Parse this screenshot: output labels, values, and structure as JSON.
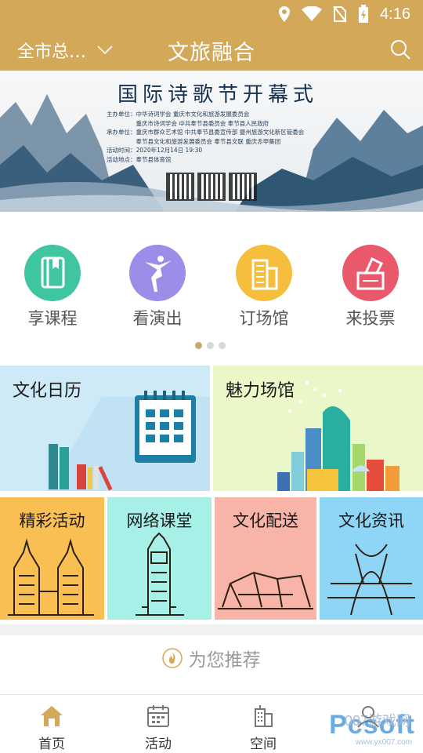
{
  "status": {
    "time": "4:16"
  },
  "header": {
    "city": "全市总…",
    "title": "文旅融合"
  },
  "banner": {
    "title": "国际诗歌节开幕式",
    "lines": [
      "主办单位：中华诗词学会  重庆市文化和旅游发展委员会",
      "　　　　　重庆市诗词学会  中共奉节县委员会  奉节县人民政府",
      "承办单位：重庆市群众艺术馆  中共奉节县委宣传部  夔州旅游文化新区管委会",
      "　　　　　奉节县文化和旅游发展委员会  奉节县文联  重庆赤甲集团",
      "活动时间：2020年12月14日  19:30",
      "活动地点：奉节县体育馆"
    ]
  },
  "quick": [
    {
      "label": "享课程",
      "color": "#3fc5a0"
    },
    {
      "label": "看演出",
      "color": "#9b8de8"
    },
    {
      "label": "订场馆",
      "color": "#f5be3c"
    },
    {
      "label": "来投票",
      "color": "#e9596b"
    }
  ],
  "cards": {
    "calendar": "文化日历",
    "venue": "魅力场馆",
    "activity": "精彩活动",
    "online": "网络课堂",
    "delivery": "文化配送",
    "news": "文化资讯"
  },
  "recommend": "为您推荐",
  "nav": [
    {
      "label": "首页",
      "active": true
    },
    {
      "label": "活动",
      "active": false
    },
    {
      "label": "空间",
      "active": false
    }
  ],
  "watermark": {
    "brand": "Pcsoft",
    "site": "007游戏网",
    "url": "www.yx007.com"
  },
  "colors": {
    "accent": "#d4a859",
    "calendar_bg": "#cfeaf7",
    "venue_bg": "#eaf7c9",
    "activity_bg": "#f9bf53",
    "online_bg": "#a7f0e7",
    "delivery_bg": "#f8b4a6",
    "news_bg": "#8fd6f6"
  }
}
